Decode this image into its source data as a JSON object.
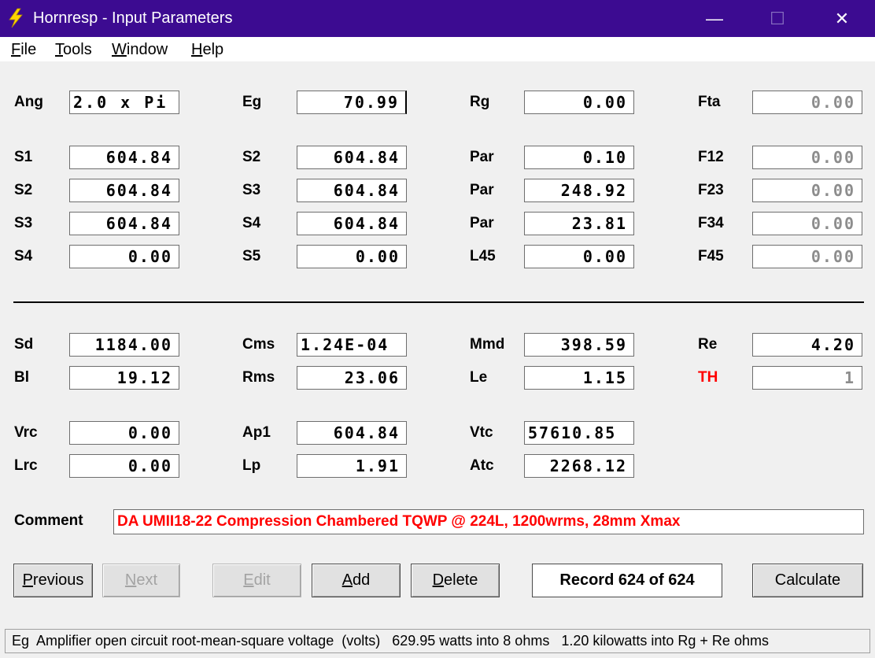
{
  "window": {
    "title": "Hornresp - Input Parameters",
    "minimize": "—",
    "maximize": "☐",
    "close": "✕"
  },
  "menu": [
    {
      "key": "F",
      "rest": "ile"
    },
    {
      "key": "T",
      "rest": "ools"
    },
    {
      "key": "W",
      "rest": "indow"
    },
    {
      "key": "H",
      "rest": "elp"
    }
  ],
  "params": {
    "ang": {
      "label": "Ang",
      "value": "2.0 x Pi"
    },
    "eg": {
      "label": "Eg",
      "value": "70.99"
    },
    "rg": {
      "label": "Rg",
      "value": "0.00"
    },
    "fta": {
      "label": "Fta",
      "value": "0.00"
    },
    "s1a": {
      "label": "S1",
      "value": "604.84"
    },
    "s2b": {
      "label": "S2",
      "value": "604.84"
    },
    "par1": {
      "label": "Par",
      "value": "0.10"
    },
    "f12": {
      "label": "F12",
      "value": "0.00"
    },
    "s2a": {
      "label": "S2",
      "value": "604.84"
    },
    "s3b": {
      "label": "S3",
      "value": "604.84"
    },
    "par2": {
      "label": "Par",
      "value": "248.92"
    },
    "f23": {
      "label": "F23",
      "value": "0.00"
    },
    "s3a": {
      "label": "S3",
      "value": "604.84"
    },
    "s4b": {
      "label": "S4",
      "value": "604.84"
    },
    "par3": {
      "label": "Par",
      "value": "23.81"
    },
    "f34": {
      "label": "F34",
      "value": "0.00"
    },
    "s4a": {
      "label": "S4",
      "value": "0.00"
    },
    "s5": {
      "label": "S5",
      "value": "0.00"
    },
    "l45": {
      "label": "L45",
      "value": "0.00"
    },
    "f45": {
      "label": "F45",
      "value": "0.00"
    },
    "sd": {
      "label": "Sd",
      "value": "1184.00"
    },
    "cms": {
      "label": "Cms",
      "value": "1.24E-04"
    },
    "mmd": {
      "label": "Mmd",
      "value": "398.59"
    },
    "re": {
      "label": "Re",
      "value": "4.20"
    },
    "bl": {
      "label": "Bl",
      "value": "19.12"
    },
    "rms": {
      "label": "Rms",
      "value": "23.06"
    },
    "le": {
      "label": "Le",
      "value": "1.15"
    },
    "th": {
      "label": "TH",
      "value": "1"
    },
    "vrc": {
      "label": "Vrc",
      "value": "0.00"
    },
    "ap1": {
      "label": "Ap1",
      "value": "604.84"
    },
    "vtc": {
      "label": "Vtc",
      "value": "57610.85"
    },
    "lrc": {
      "label": "Lrc",
      "value": "0.00"
    },
    "lp": {
      "label": "Lp",
      "value": "1.91"
    },
    "atc": {
      "label": "Atc",
      "value": "2268.12"
    }
  },
  "comment": {
    "label": "Comment",
    "value": "DA UMII18-22 Compression Chambered TQWP @ 224L, 1200wrms, 28mm Xmax"
  },
  "buttons": {
    "previous": {
      "key": "P",
      "rest": "revious"
    },
    "next": {
      "key": "N",
      "rest": "ext"
    },
    "edit": {
      "key": "E",
      "rest": "dit"
    },
    "add": {
      "key": "A",
      "rest": "dd"
    },
    "delete": {
      "key": "D",
      "rest": "elete"
    },
    "calculate": "Calculate"
  },
  "record": "Record 624 of 624",
  "status": "Eg  Amplifier open circuit root-mean-square voltage  (volts)   629.95 watts into 8 ohms   1.20 kilowatts into Rg + Re ohms",
  "colors": {
    "titlebar": "#3c0b91",
    "comment_text": "#ff0000",
    "th_label": "#ff0000"
  }
}
